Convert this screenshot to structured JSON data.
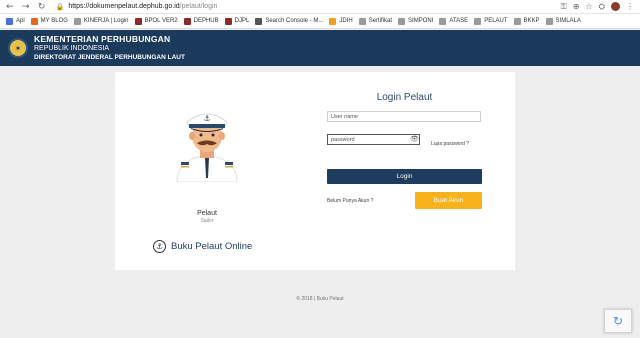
{
  "browser": {
    "url_host": "https://dokumenpelaut.dephub.go.id",
    "url_path": "/pelaut/login",
    "bookmarks": [
      {
        "label": "Apl",
        "color": "#4a6fdc"
      },
      {
        "label": "MY BLOG",
        "color": "#e06b1f"
      },
      {
        "label": "KINERJA | Login",
        "color": "#999999"
      },
      {
        "label": "BPOL VER2",
        "color": "#8a2b2b"
      },
      {
        "label": "DEPHUB",
        "color": "#8a2b2b"
      },
      {
        "label": "DJPL",
        "color": "#8a2b2b"
      },
      {
        "label": "Search Console - M...",
        "color": "#555555"
      },
      {
        "label": "JDIH",
        "color": "#f0a020"
      },
      {
        "label": "Sertifikat",
        "color": "#999999"
      },
      {
        "label": "SIMPONI",
        "color": "#999999"
      },
      {
        "label": "ATASE",
        "color": "#999999"
      },
      {
        "label": "PELAUT",
        "color": "#999999"
      },
      {
        "label": "BKKP",
        "color": "#999999"
      },
      {
        "label": "SIMLALA",
        "color": "#999999"
      }
    ]
  },
  "header": {
    "line1": "KEMENTERIAN PERHUBUNGAN",
    "line2": "REPUBLIK INDONESIA",
    "line3": "DIREKTORAT JENDERAL PERHUBUNGAN LAUT"
  },
  "profile": {
    "name": "Pelaut",
    "subtitle": "Sailor"
  },
  "login": {
    "title": "Login Pelaut",
    "username_placeholder": "User name",
    "password_value": "password",
    "forgot_label": "Lupa password ?",
    "login_button": "Login",
    "no_account_label": "Belum Punya Akun ?",
    "create_account_button": "Buat Akun"
  },
  "brand": {
    "title": "Buku Pelaut Online"
  },
  "footer": {
    "text": "© 2018 | Buku Pelaut"
  }
}
